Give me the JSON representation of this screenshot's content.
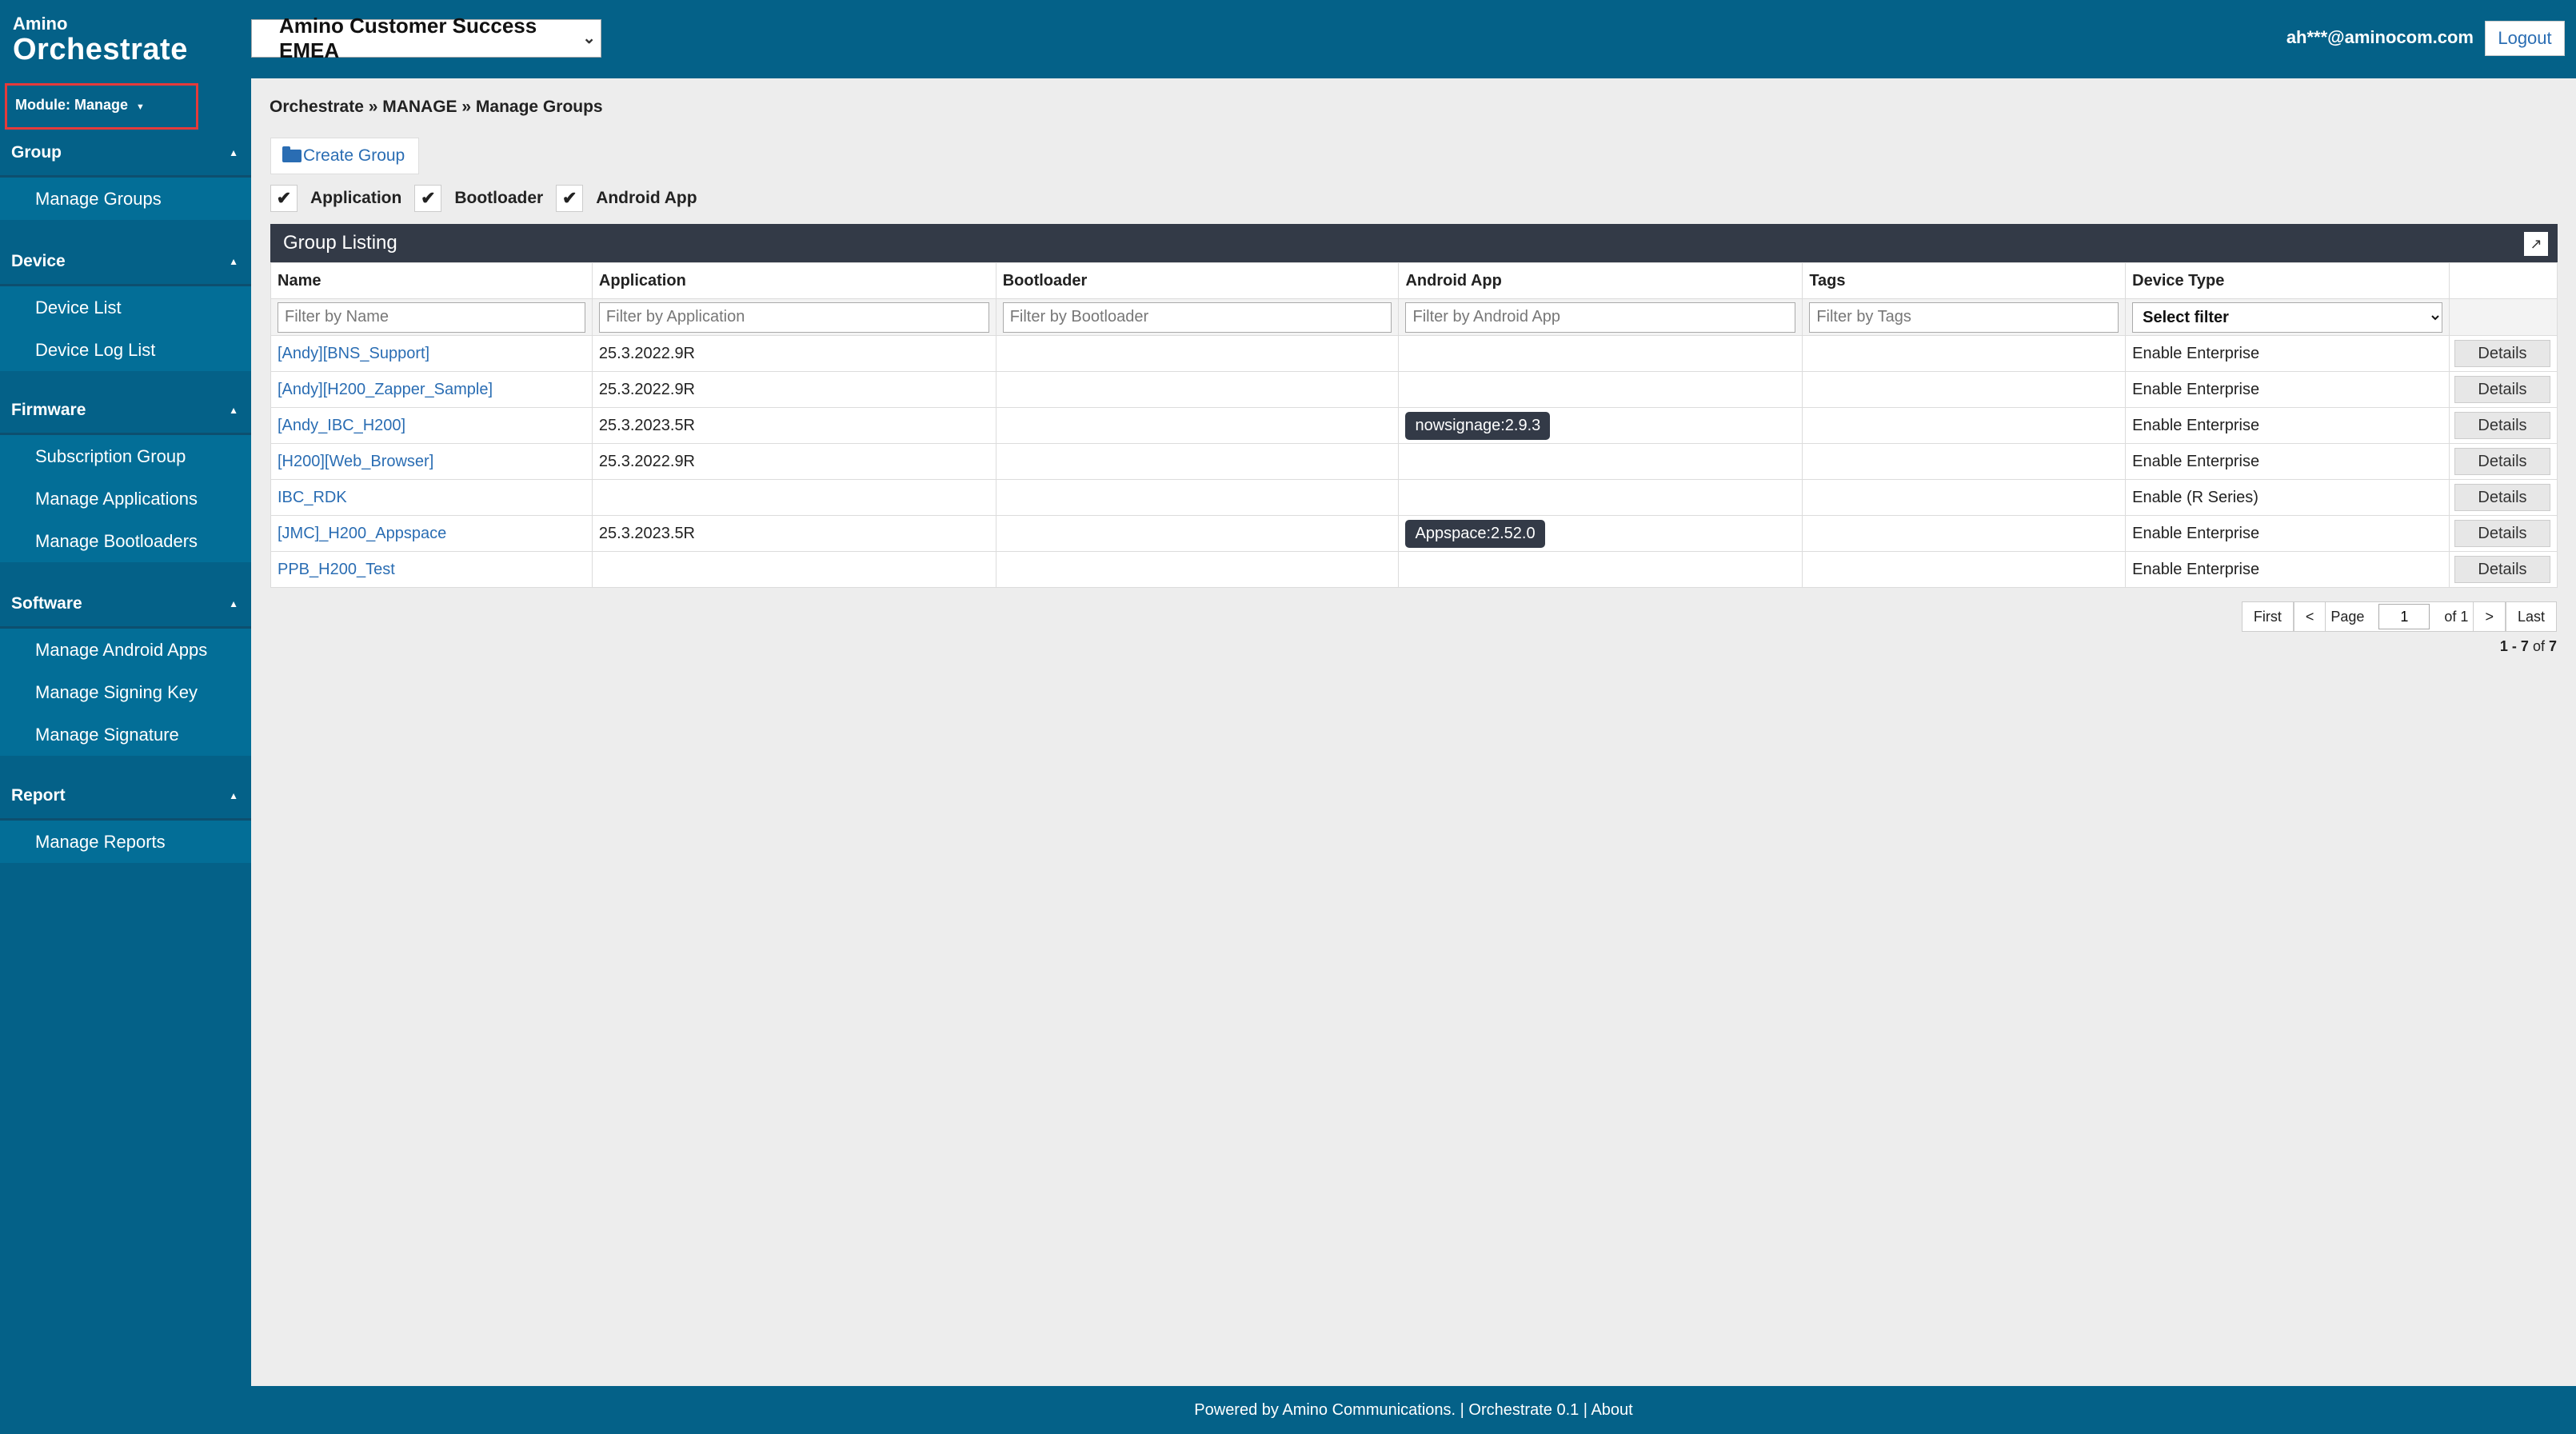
{
  "header": {
    "logo_small": "Amino",
    "logo_big": "Orchestrate",
    "tenant": "Amino Customer Success EMEA",
    "user_email": "ah***@aminocom.com",
    "logout": "Logout"
  },
  "sidebar": {
    "module": "Module: Manage",
    "sections": [
      {
        "title": "Group",
        "items": [
          "Manage Groups"
        ]
      },
      {
        "title": "Device",
        "items": [
          "Device List",
          "Device Log List"
        ]
      },
      {
        "title": "Firmware",
        "items": [
          "Subscription Group",
          "Manage Applications",
          "Manage Bootloaders"
        ]
      },
      {
        "title": "Software",
        "items": [
          "Manage Android Apps",
          "Manage Signing Key",
          "Manage Signature"
        ]
      },
      {
        "title": "Report",
        "items": [
          "Manage Reports"
        ]
      }
    ]
  },
  "breadcrumb": "Orchestrate » MANAGE » Manage Groups",
  "create_group": "Create Group",
  "column_toggles": [
    "Application",
    "Bootloader",
    "Android App"
  ],
  "grid": {
    "title": "Group Listing",
    "columns": [
      "Name",
      "Application",
      "Bootloader",
      "Android App",
      "Tags",
      "Device Type"
    ],
    "filters": [
      "Filter by Name",
      "Filter by Application",
      "Filter by Bootloader",
      "Filter by Android App",
      "Filter by Tags"
    ],
    "select_filter": "Select filter",
    "details_label": "Details",
    "rows": [
      {
        "name": "[Andy][BNS_Support]",
        "application": "25.3.2022.9R",
        "bootloader": "",
        "android_app": "",
        "tags": "",
        "device_type": "Enable Enterprise"
      },
      {
        "name": "[Andy][H200_Zapper_Sample]",
        "application": "25.3.2022.9R",
        "bootloader": "",
        "android_app": "",
        "tags": "",
        "device_type": "Enable Enterprise"
      },
      {
        "name": "[Andy_IBC_H200]",
        "application": "25.3.2023.5R",
        "bootloader": "",
        "android_app": "nowsignage:2.9.3",
        "tags": "",
        "device_type": "Enable Enterprise"
      },
      {
        "name": "[H200][Web_Browser]",
        "application": "25.3.2022.9R",
        "bootloader": "",
        "android_app": "",
        "tags": "",
        "device_type": "Enable Enterprise"
      },
      {
        "name": "IBC_RDK",
        "application": "",
        "bootloader": "",
        "android_app": "",
        "tags": "",
        "device_type": "Enable (R Series)"
      },
      {
        "name": "[JMC]_H200_Appspace",
        "application": "25.3.2023.5R",
        "bootloader": "",
        "android_app": "Appspace:2.52.0",
        "tags": "",
        "device_type": "Enable Enterprise"
      },
      {
        "name": "PPB_H200_Test",
        "application": "",
        "bootloader": "",
        "android_app": "",
        "tags": "",
        "device_type": "Enable Enterprise"
      }
    ]
  },
  "pager": {
    "first": "First",
    "prev": "<",
    "page_label": "Page",
    "page": "1",
    "of": "of 1",
    "next": ">",
    "last": "Last",
    "records_range": "1 - 7",
    "records_of": "of",
    "records_total": "7"
  },
  "footer": "Powered by Amino Communications. | Orchestrate 0.1 | About"
}
